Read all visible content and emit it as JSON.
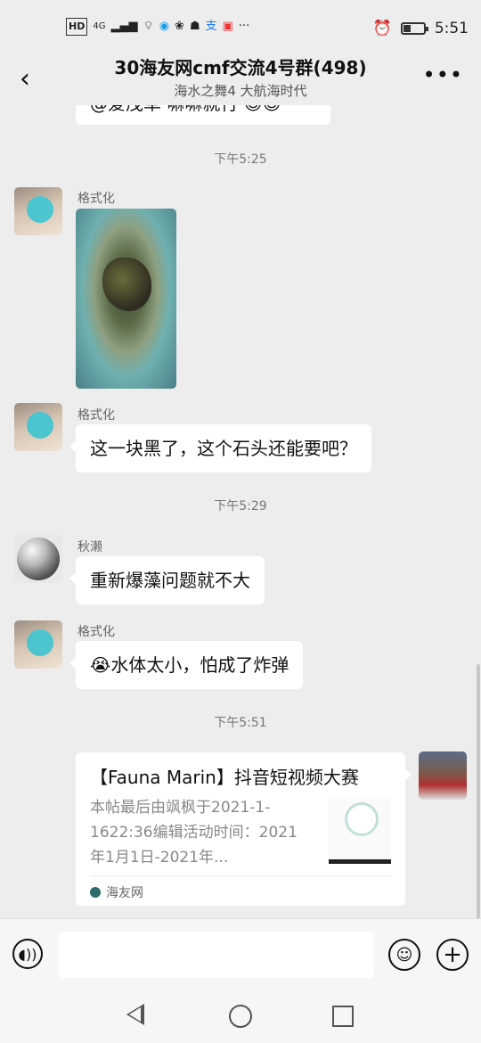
{
  "status_bar": {
    "left_label": "HD",
    "network_label": "4G",
    "time": "5:51",
    "battery_level": 0.35
  },
  "header": {
    "title": "30海友网cmf交流4号群(498)",
    "subtitle": "海水之舞4 大航海时代",
    "back_icon": "chevron-left-icon",
    "more_icon": "more-dots-icon"
  },
  "messages": [
    {
      "type": "text-partial",
      "text": "@爱茂草 嘛嘛就行 😊😊"
    },
    {
      "type": "time",
      "text": "下午5:25"
    },
    {
      "type": "image",
      "sender": "格式化"
    },
    {
      "type": "text",
      "sender": "格式化",
      "text": "这一块黑了，这个石头还能要吧？"
    },
    {
      "type": "time",
      "text": "下午5:29"
    },
    {
      "type": "text",
      "sender": "秋濑",
      "text": "重新爆藻问题就不大"
    },
    {
      "type": "text",
      "sender": "格式化",
      "text": "😭水体太小，怕成了炸弹"
    },
    {
      "type": "time",
      "text": "下午5:51"
    }
  ],
  "card": {
    "title": "【Fauna Marin】抖音短视频大赛",
    "description": "本帖最后由飒枫于2021-1-1622:36编辑活动时间：2021年1月1日-2021年...",
    "source": "海友网"
  },
  "input_bar": {
    "voice_icon": "voice-icon",
    "emoji_icon": "emoji-icon",
    "plus_icon": "plus-icon"
  },
  "nav_bar": {
    "back": "nav-back-icon",
    "home": "nav-home-icon",
    "recent": "nav-recent-icon"
  }
}
